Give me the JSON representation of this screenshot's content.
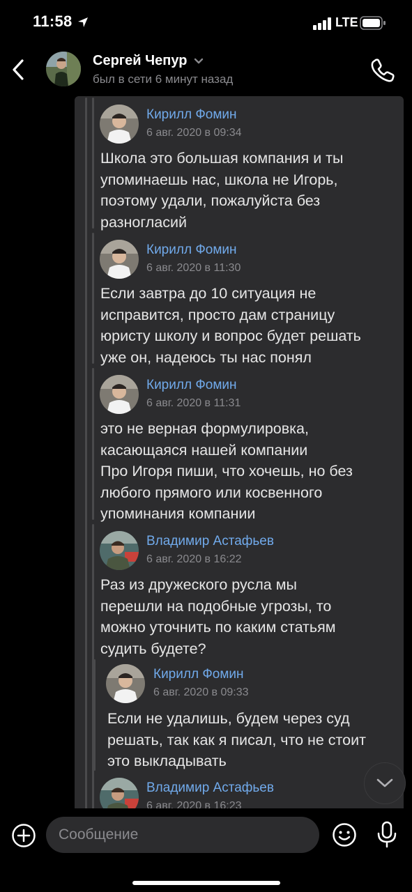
{
  "status_bar": {
    "time": "11:58",
    "network": "LTE"
  },
  "header": {
    "contact_name": "Сергей Чепур",
    "last_seen": "был в сети 6 минут назад"
  },
  "messages": [
    {
      "author": "Кирилл Фомин",
      "date": "6 авг. 2020 в 09:34",
      "text": "Школа это большая компания и ты\nупоминаешь нас, школа не Игорь,\nпоэтому удали, пожалуйста без\nразногласий"
    },
    {
      "author": "Кирилл Фомин",
      "date": "6 авг. 2020 в 11:30",
      "text": "Если завтра до 10 ситуация не\nисправится, просто дам страницу\nюристу школу и вопрос будет решать\nуже он, надеюсь ты нас понял"
    },
    {
      "author": "Кирилл Фомин",
      "date": "6 авг. 2020 в 11:31",
      "text": "это не верная формулировка,\nкасающаяся нашей компании\nПро Игоря пиши, что хочешь, но без\nлюбого прямого или косвенного\nупоминания компании"
    },
    {
      "author": "Владимир Астафьев",
      "date": "6 авг. 2020 в 16:22",
      "text": "Раз из дружеского русла мы\nперешли на подобные угрозы, то\nможно уточнить по каким статьям\nсудить будете?"
    },
    {
      "author": "Кирилл Фомин",
      "date": "6 авг. 2020 в 09:33",
      "text": "Если не удалишь, будем через суд\nрешать, так как я писал, что не стоит\nэто выкладывать"
    },
    {
      "author": "Владимир Астафьев",
      "date": "6 авг. 2020 в 16:23",
      "text": ""
    }
  ],
  "composer": {
    "placeholder": "Сообщение"
  },
  "colors": {
    "background": "#000000",
    "bubble": "#2c2c2e",
    "author_link": "#71aaeb",
    "secondary_text": "#8a8a8e"
  },
  "icons": [
    "back-arrow-icon",
    "chevron-down-icon",
    "phone-icon",
    "plus-circle-icon",
    "emoji-icon",
    "mic-icon",
    "scroll-down-chevron-icon"
  ]
}
